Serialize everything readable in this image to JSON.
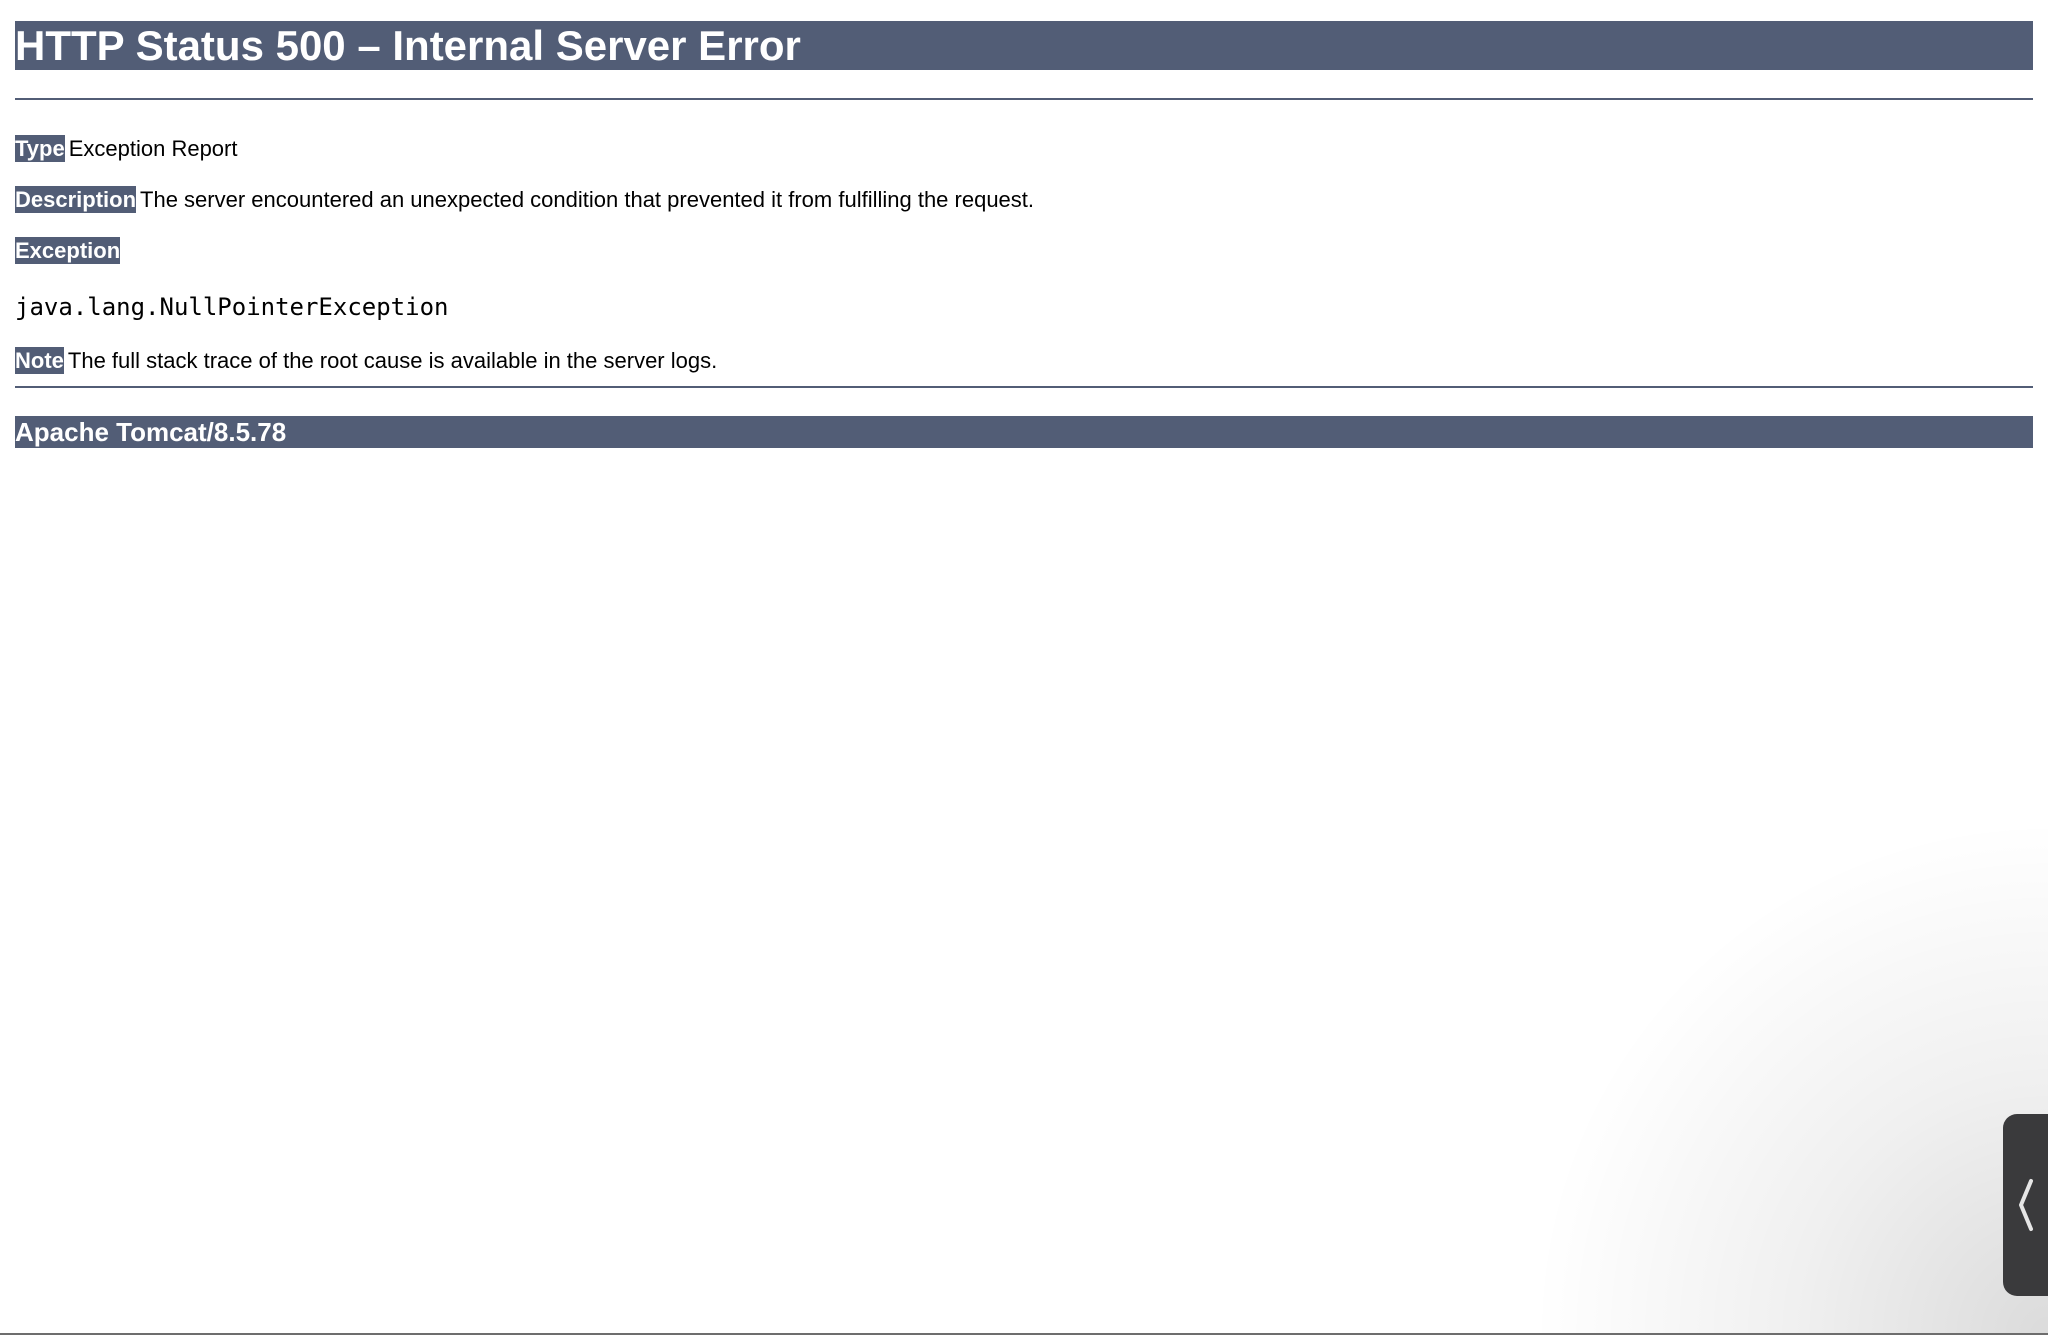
{
  "error_page": {
    "title": "HTTP Status 500 – Internal Server Error",
    "type_label": "Type",
    "type_value": "Exception Report",
    "description_label": "Description",
    "description_value": "The server encountered an unexpected condition that prevented it from fulfilling the request.",
    "exception_label": "Exception",
    "exception_value": "java.lang.NullPointerException",
    "note_label": "Note",
    "note_value": "The full stack trace of the root cause is available in the server logs.",
    "footer": "Apache Tomcat/8.5.78"
  },
  "side_handle": {
    "icon": "chevron-left-icon"
  },
  "colors": {
    "header_bg": "#525d76",
    "header_text": "#ffffff",
    "handle_bg": "#3a3a3c"
  }
}
